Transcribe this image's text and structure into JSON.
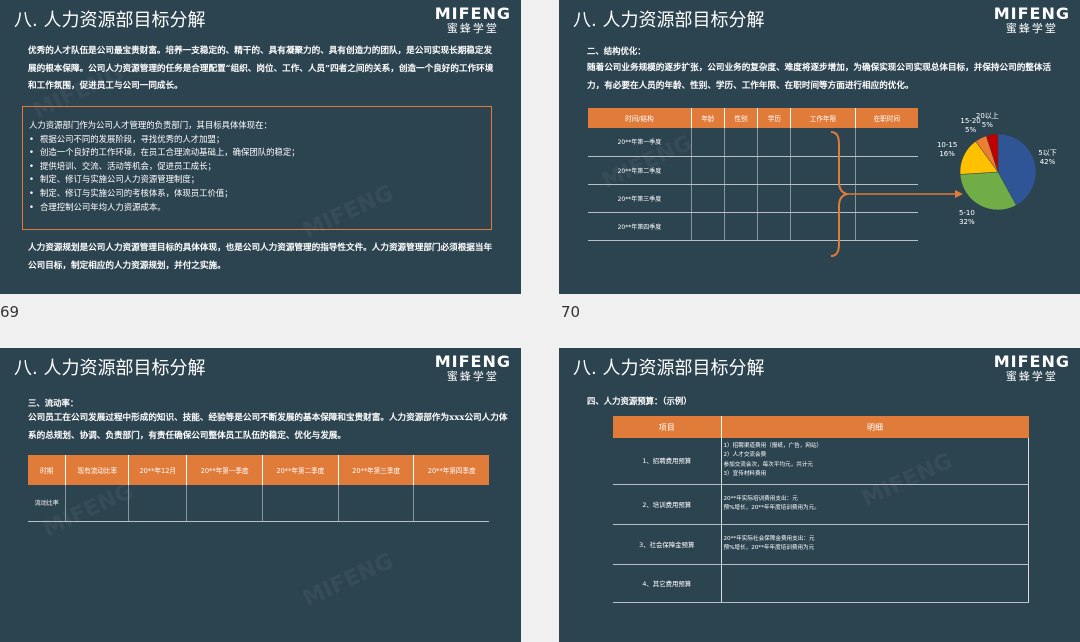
{
  "brand": {
    "logo_en": "MIFENG",
    "logo_cn": "蜜蜂学堂"
  },
  "slide_numbers": {
    "s1": "69",
    "s2": "70"
  },
  "colors": {
    "slide_bg": "#2c4350",
    "accent": "#e07b39"
  },
  "slide1": {
    "title": "八. 人力资源部目标分解",
    "intro": "优秀的人才队伍是公司最宝贵财富。培养一支稳定的、精干的、具有凝聚力的、具有创造力的团队，是公司实现长期稳定发展的根本保障。公司人力资源管理的任务是合理配置“组织、岗位、工作、人员”四者之间的关系，创造一个良好的工作环境和工作氛围，促进员工与公司一同成长。",
    "box_lead": "人力资源部门作为公司人才管理的负责部门，其目标具体体现在：",
    "box_items": [
      "根据公司不同的发展阶段，寻找优秀的人才加盟；",
      "创造一个良好的工作环境，在员工合理流动基础上，确保团队的稳定；",
      "提供培训、交流、活动等机会，促进员工成长；",
      "制定、修订与实施公司人力资源管理制度；",
      "制定、修订与实施公司的考核体系，体现员工价值；",
      "合理控制公司年均人力资源成本。"
    ],
    "outro": "人力资源规划是公司人力资源管理目标的具体体现，也是公司人力资源管理的指导性文件。人力资源管理部门必须根据当年公司目标，制定相应的人力资源规划，并付之实施。"
  },
  "slide2": {
    "title": "八. 人力资源部目标分解",
    "heading": "二、结构优化：",
    "para": "随着公司业务规模的逐步扩张，公司业务的复杂度、难度将逐步增加，为确保实现公司实现总体目标，并保持公司的整体活力，有必要在人员的年龄、性别、学历、工作年限、在职时间等方面进行相应的优化。",
    "table_headers": [
      "时间/结构",
      "年龄",
      "性别",
      "学历",
      "工作年限",
      "在职时间"
    ],
    "table_rows": [
      "20**年第一季度",
      "20**年第二季度",
      "20**年第三季度",
      "20**年第四季度"
    ]
  },
  "chart_data": {
    "type": "pie",
    "categories": [
      "5以下",
      "5-10",
      "10-15",
      "15-20",
      "20以上"
    ],
    "values": [
      42,
      32,
      16,
      5,
      5
    ],
    "labels": [
      "5以下\n42%",
      "5-10\n32%",
      "10-15\n16%",
      "15-20\n5%",
      "20以上\n5%"
    ],
    "colors": [
      "#2f5597",
      "#70ad47",
      "#ffc000",
      "#ed7d31",
      "#c00000"
    ]
  },
  "slide3": {
    "title": "八. 人力资源部目标分解",
    "heading": "三、流动率：",
    "para": "公司员工在公司发展过程中形成的知识、技能、经验等是公司不断发展的基本保障和宝贵财富。人力资源部作为xxx公司人力体系的总规划、协调、负责部门，有责任确保公司整体员工队伍的稳定、优化与发展。",
    "table_headers": [
      "时期",
      "现有流动比率",
      "20**年12月",
      "20**年第一季度",
      "20**年第二季度",
      "20**年第三季度",
      "20**年第四季度"
    ],
    "row_label": "流动比率"
  },
  "slide4": {
    "title": "八. 人力资源部目标分解",
    "heading": "四、人力资源预算：（示例）",
    "table_headers": [
      "项目",
      "明细"
    ],
    "rows": [
      {
        "item": "1、招聘费用预算",
        "detail": "1）招聘渠道费用（报纸，广告，网站）\n2）人才交流会费\n参加交流会次，每次平均元，共计元\n3）宣传材料费用"
      },
      {
        "item": "2、培训费用预算",
        "detail": "20**年实际培训费用支出：元\n预%增长，20**年年度培训费用为元。"
      },
      {
        "item": "3、社会保障金预算",
        "detail": "20**年实际社会保障金费用支出：元\n预%增长，20**年年度培训费用为元"
      },
      {
        "item": "4、其它费用预算",
        "detail": ""
      }
    ]
  }
}
